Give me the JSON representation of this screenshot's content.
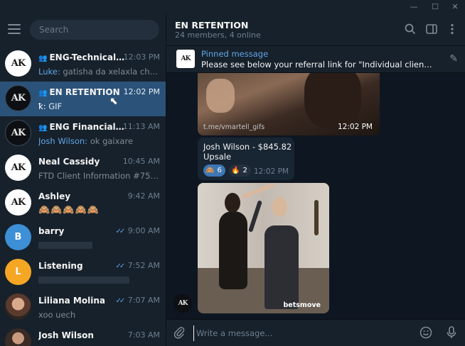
{
  "window": {
    "minimize": "—",
    "maximize": "☐",
    "close": "✕"
  },
  "search": {
    "placeholder": "Search"
  },
  "chats": [
    {
      "name": "ENG-Technical-Ret...",
      "time": "12:03 PM",
      "sender": "Luke:",
      "preview": "gatisha da xelaxla charte a...",
      "group": true
    },
    {
      "name": "EN RETENTION",
      "time": "12:02 PM",
      "sender": "ꝁ:",
      "preview": "GIF",
      "group": true
    },
    {
      "name": "ENG Financial - Bar...",
      "time": "11:13 AM",
      "sender": "Josh Wilson:",
      "preview": "ok gaixare",
      "group": true
    },
    {
      "name": "Neal Cassidy",
      "time": "10:45 AM",
      "preview": "FTD Client Information #75780 ..."
    },
    {
      "name": "Ashley",
      "time": "9:42 AM",
      "preview": "🙈🙈🙈🙈🙈"
    },
    {
      "name": "barry",
      "time": "9:00 AM",
      "avatar_letter": "B",
      "avatar_color": "#3d8fd6"
    },
    {
      "name": "Listening",
      "time": "7:52 AM",
      "avatar_letter": "L",
      "avatar_color": "#f5a623"
    },
    {
      "name": "Liliana Molina",
      "time": "7:07 AM",
      "preview": "xoo uech"
    },
    {
      "name": "Josh Wilson",
      "time": "7:03 AM"
    }
  ],
  "avatar_logo": "AK",
  "header": {
    "title": "EN RETENTION",
    "subtitle": "24 members, 4 online"
  },
  "pinned": {
    "title": "Pinned message",
    "text": "Please see below your referral link for \"Individual clients acco..."
  },
  "messages": {
    "gif1_link": "t.me/vmartell_gifs",
    "gif1_time": "12:02 PM",
    "bubble_line1": "Josh Wilson - $845.82",
    "bubble_line2": "Upsale",
    "reaction1_count": "6",
    "reaction2_count": "2",
    "bubble_time": "12:02 PM",
    "gif2_watermark": "betsmove"
  },
  "composer": {
    "placeholder": "Write a message..."
  },
  "colors": {
    "accent": "#5fa6e8",
    "active_chat": "#2b5278",
    "sidebar": "#17212b",
    "background": "#0e1621"
  }
}
